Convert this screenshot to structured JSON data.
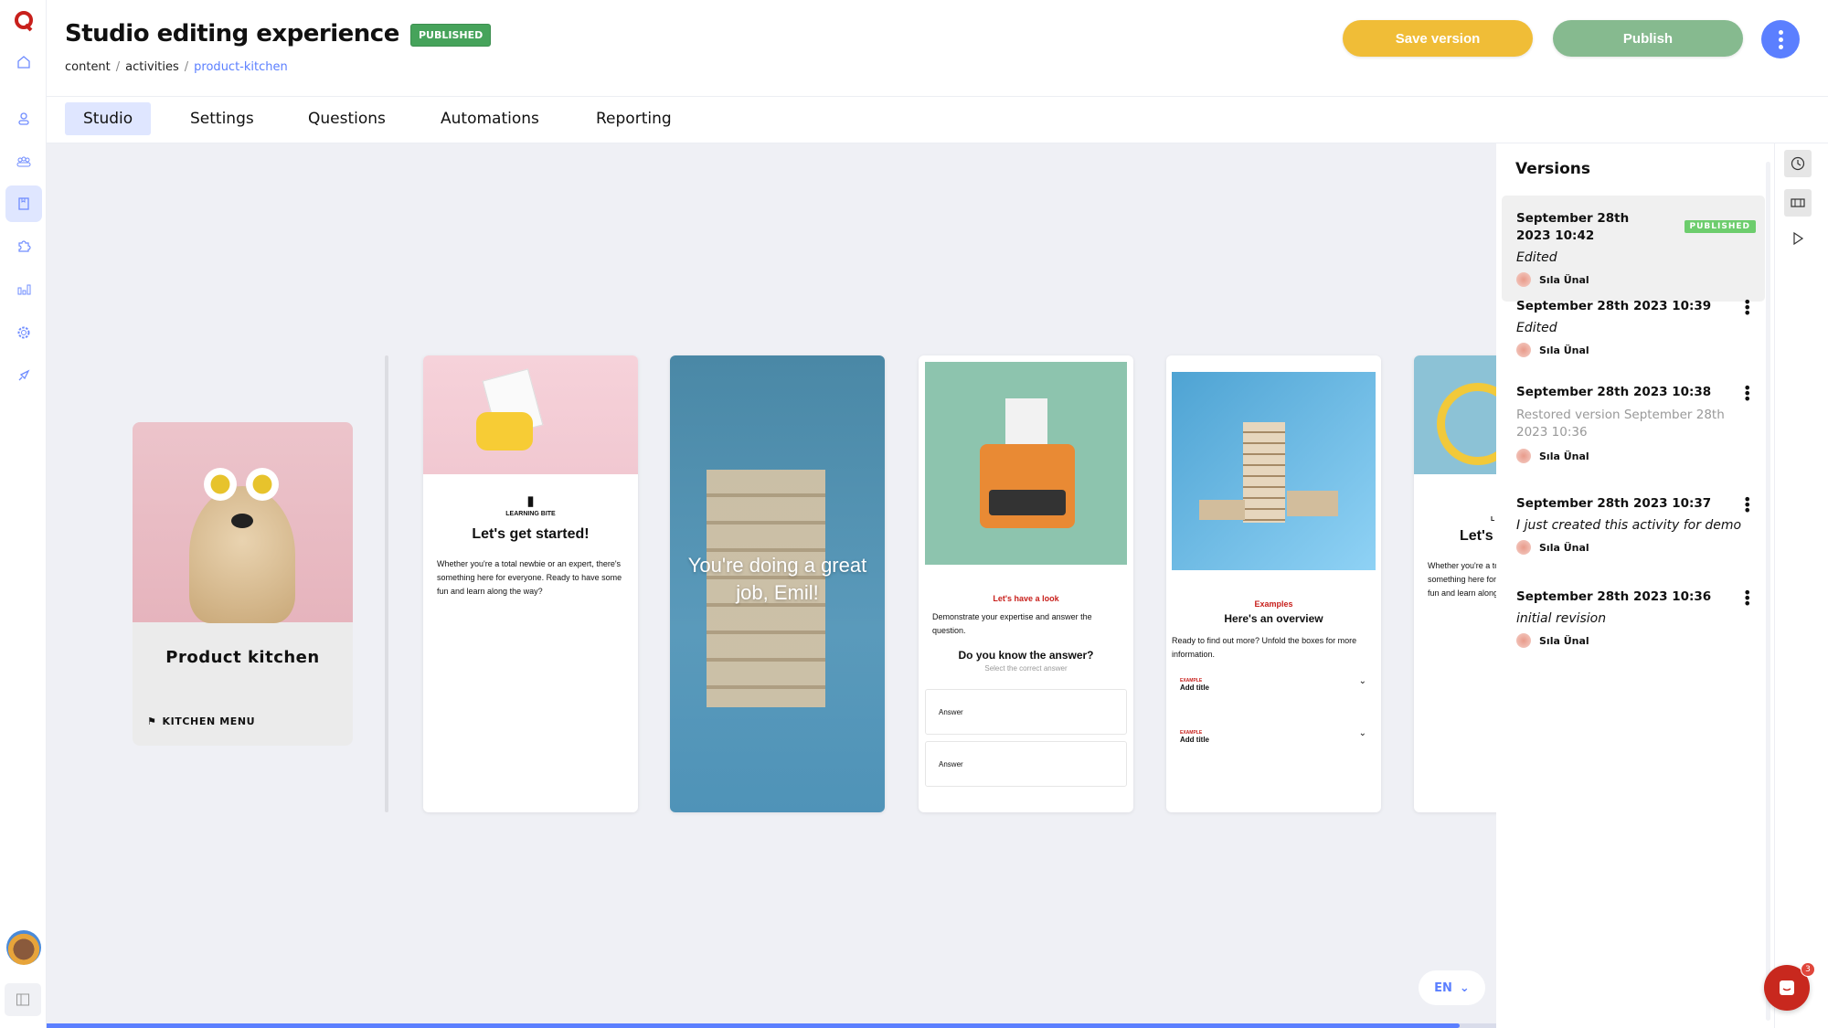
{
  "app": {
    "brand_color": "#c8201c",
    "accent": "#5b7fff"
  },
  "sidebar": {
    "items": [
      {
        "icon": "home-icon"
      },
      {
        "icon": "user-icon"
      },
      {
        "icon": "group-icon"
      },
      {
        "icon": "content-icon",
        "active": true
      },
      {
        "icon": "puzzle-icon"
      },
      {
        "icon": "chart-icon"
      },
      {
        "icon": "gear-icon"
      },
      {
        "icon": "rocket-icon"
      }
    ]
  },
  "header": {
    "title": "Studio editing experience",
    "status_badge": "PUBLISHED",
    "breadcrumb": [
      "content",
      "activities",
      "product-kitchen"
    ],
    "save_label": "Save version",
    "publish_label": "Publish",
    "save_color": "#f0bd37",
    "publish_color": "#86ba8f"
  },
  "tabs": [
    {
      "label": "Studio",
      "active": true
    },
    {
      "label": "Settings"
    },
    {
      "label": "Questions"
    },
    {
      "label": "Automations"
    },
    {
      "label": "Reporting"
    }
  ],
  "cover": {
    "title": "Product kitchen",
    "menu_label": "KITCHEN MENU"
  },
  "cards": {
    "c1": {
      "kicker": "LEARNING BITE",
      "title": "Let's get started!",
      "body": "Whether you're a total newbie or an expert, there's something here for everyone. Ready to have some fun and learn along the way?"
    },
    "c2": {
      "title": "You're doing a great job, Emil!"
    },
    "c3": {
      "kicker": "Let's have a look",
      "body": "Demonstrate your expertise and answer the question.",
      "question": "Do you know the answer?",
      "hint": "Select the correct answer",
      "answers": [
        "Answer",
        "Answer"
      ]
    },
    "c4": {
      "kicker": "Examples",
      "title": "Here's an overview",
      "body": "Ready to find out more? Unfold the boxes for more information.",
      "items": [
        {
          "label": "EXAMPLE",
          "title": "Add title"
        },
        {
          "label": "EXAMPLE",
          "title": "Add title"
        }
      ]
    },
    "c5": {
      "kicker": "L",
      "title": "Let's",
      "body": "Whether you're a total newbie or an expert, there's something here for everyone. Ready to have some fun and learn along the way?"
    }
  },
  "language": {
    "selected": "EN"
  },
  "progress": {
    "percent": 97.5
  },
  "chat": {
    "badge": "3"
  },
  "versions": {
    "title": "Versions",
    "items": [
      {
        "date": "September 28th 2023 10:42",
        "note": "Edited",
        "user": "Sıla Ünal",
        "badge": "PUBLISHED",
        "selected": true
      },
      {
        "date": "September 28th 2023 10:39",
        "note": "Edited",
        "user": "Sıla Ünal"
      },
      {
        "date": "September 28th 2023 10:38",
        "note": "Restored version September 28th 2023 10:36",
        "user": "Sıla Ünal",
        "muted": true
      },
      {
        "date": "September 28th 2023 10:37",
        "note": "I just created this activity for demo",
        "user": "Sıla Ünal"
      },
      {
        "date": "September 28th 2023 10:36",
        "note": "initial revision",
        "user": "Sıla Ünal"
      }
    ]
  }
}
